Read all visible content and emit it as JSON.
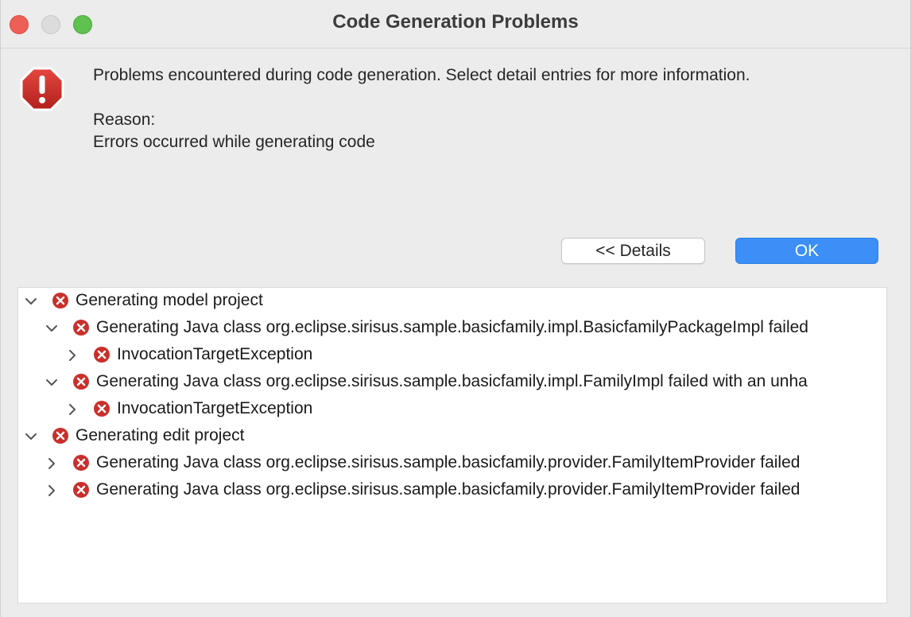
{
  "window": {
    "title": "Code Generation Problems"
  },
  "dialog": {
    "message": "Problems encountered during code generation. Select detail entries for more information.",
    "reason_label": "Reason:",
    "reason_text": "Errors occurred while generating code"
  },
  "buttons": {
    "details_label": "<< Details",
    "ok_label": "OK"
  },
  "colors": {
    "ok_button": "#3b8ff6",
    "error_icon": "#c9302c"
  },
  "tree": {
    "rows": [
      {
        "label": "Generating model project",
        "expanded": true,
        "level": 0,
        "icon": "error-icon"
      },
      {
        "label": "Generating Java class org.eclipse.sirisus.sample.basicfamily.impl.BasicfamilyPackageImpl failed",
        "expanded": true,
        "level": 1,
        "icon": "error-icon"
      },
      {
        "label": "InvocationTargetException",
        "expanded": false,
        "level": 2,
        "icon": "error-icon"
      },
      {
        "label": "Generating Java class org.eclipse.sirisus.sample.basicfamily.impl.FamilyImpl failed with an unha",
        "expanded": true,
        "level": 1,
        "icon": "error-icon"
      },
      {
        "label": "InvocationTargetException",
        "expanded": false,
        "level": 2,
        "icon": "error-icon"
      },
      {
        "label": "Generating edit project",
        "expanded": true,
        "level": 0,
        "icon": "error-icon"
      },
      {
        "label": "Generating Java class org.eclipse.sirisus.sample.basicfamily.provider.FamilyItemProvider failed",
        "expanded": false,
        "level": 1,
        "icon": "error-icon"
      },
      {
        "label": "Generating Java class org.eclipse.sirisus.sample.basicfamily.provider.FamilyItemProvider failed",
        "expanded": false,
        "level": 1,
        "icon": "error-icon"
      }
    ]
  }
}
